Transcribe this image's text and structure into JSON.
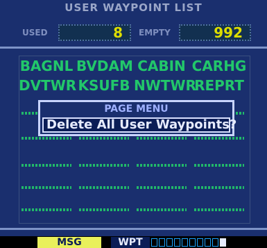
{
  "title": "USER WAYPOINT LIST",
  "used": {
    "label": "USED",
    "value": "8"
  },
  "empty": {
    "label": "EMPTY",
    "value": "992"
  },
  "waypoints": [
    "BAGNL",
    "BVDAM",
    "CABIN",
    "CARHG",
    "DVTWR",
    "KSUFB",
    "NWTWR",
    "REPRT"
  ],
  "menu": {
    "title": "PAGE MENU",
    "item": "Delete All User Waypoints?"
  },
  "status": {
    "msg": "MSG",
    "wpt": "WPT",
    "progress": 0.9
  },
  "colors": {
    "bg": "#1a2f6e",
    "green": "#22c76a",
    "yellow": "#e9f05b"
  }
}
